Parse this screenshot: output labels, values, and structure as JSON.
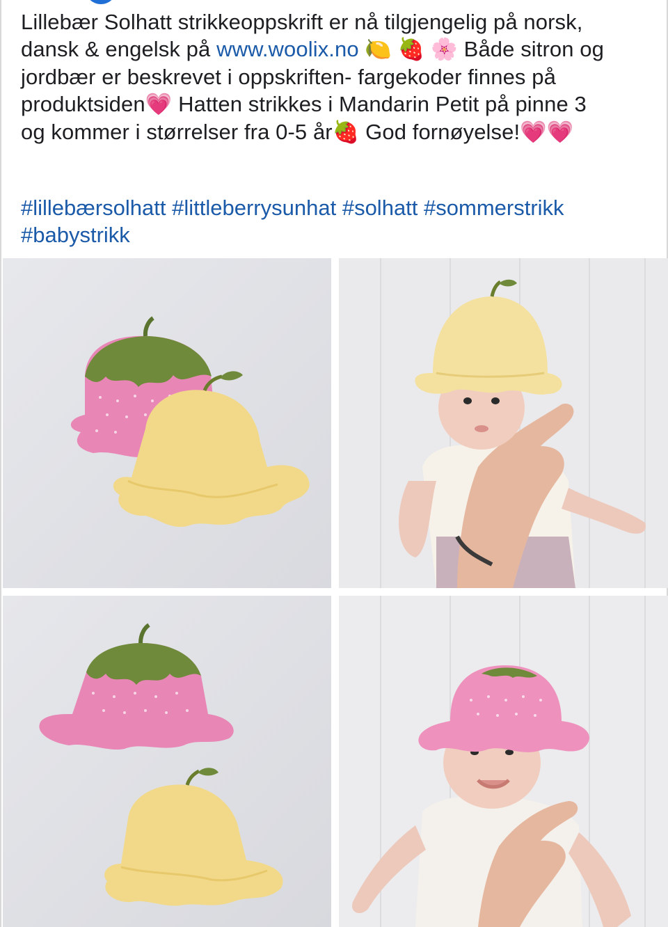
{
  "post": {
    "caption_lines": [
      "Lillebær Solhatt strikkeoppskrift er nå tilgjengelig på norsk,",
      "dansk & engelsk på ",
      "www.woolix.no",
      " Både sitron og",
      "jordbær er beskrevet i oppskriften- fargekoder finnes på",
      "produktsiden",
      " Hatten strikkes i Mandarin Petit på pinne 3",
      "og kommer i størrelser fra 0-5 år",
      " God fornøyelse!"
    ],
    "emoji": {
      "lemon": "🍋",
      "strawberry": "🍓",
      "blossom": "🌸",
      "heart": "💗"
    },
    "hashtags": [
      "#lillebærsolhatt",
      "#littleberrysunhat",
      "#solhatt",
      "#sommerstrikk",
      "#babystrikk"
    ]
  },
  "photos": [
    {
      "icon": "photo-hats-flatlay"
    },
    {
      "icon": "photo-baby-yellow-hat"
    },
    {
      "icon": "photo-hats-stacked"
    },
    {
      "icon": "photo-baby-pink-hat"
    }
  ],
  "colors": {
    "text": "#1c1e21",
    "link": "#1a5aa8",
    "pink_hat": "#e886b6",
    "yellow_hat": "#f2d98a",
    "leaf": "#6f8a3a"
  }
}
